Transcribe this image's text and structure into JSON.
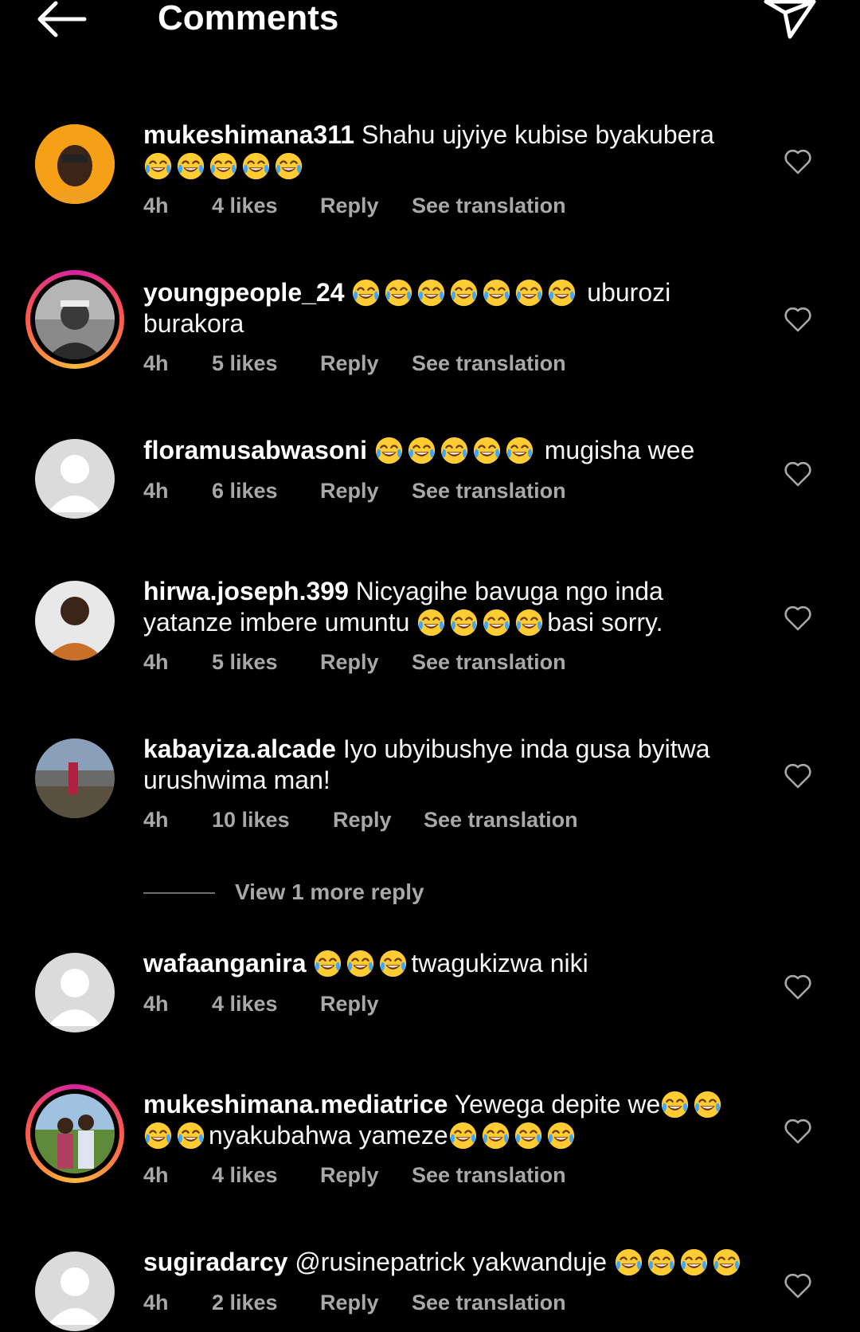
{
  "header": {
    "title": "Comments",
    "back_icon": "arrow-left-icon",
    "share_icon": "send-icon"
  },
  "colors": {
    "background": "#000000",
    "text": "#f5f5f5",
    "meta": "#a8a8a8",
    "story_ring": "#d6249f"
  },
  "comments": [
    {
      "username": "mukeshimana311",
      "text_before": " Shahu ujyiye kubise byakubera",
      "emojis_after_count": 5,
      "time": "4h",
      "likes": "4 likes",
      "reply": "Reply",
      "translation": "See translation",
      "avatar": "avatar-photo",
      "story_ring": false
    },
    {
      "username": "youngpeople_24",
      "emojis_inline_count": 7,
      "text_after": " uburozi burakora",
      "time": "4h",
      "likes": "5 likes",
      "reply": "Reply",
      "translation": "See translation",
      "avatar": "avatar-photo",
      "story_ring": true
    },
    {
      "username": "floramusabwasoni",
      "emojis_inline_count": 5,
      "text_after": " mugisha wee",
      "time": "4h",
      "likes": "6 likes",
      "reply": "Reply",
      "translation": "See translation",
      "avatar": "default-avatar",
      "story_ring": false
    },
    {
      "username": "hirwa.joseph.399",
      "text_before": " Nicyagihe bavuga ngo inda yatanze imbere umuntu ",
      "emojis_inline_count": 4,
      "text_after": "basi sorry.",
      "time": "4h",
      "likes": "5 likes",
      "reply": "Reply",
      "translation": "See translation",
      "avatar": "avatar-photo",
      "story_ring": false
    },
    {
      "username": "kabayiza.alcade",
      "text_before": " Iyo ubyibushye inda gusa byitwa urushwima man!",
      "time": "4h",
      "likes": "10 likes",
      "reply": "Reply",
      "translation": "See translation",
      "avatar": "avatar-photo",
      "story_ring": false
    },
    {
      "username": "wafaanganira",
      "emojis_inline_count": 3,
      "text_after": "twagukizwa niki",
      "time": "4h",
      "likes": "4 likes",
      "reply": "Reply",
      "avatar": "default-avatar",
      "story_ring": false
    },
    {
      "username": "mukeshimana.mediatrice",
      "text_before": " Yewega depite we",
      "emojis_inline_count": 4,
      "text_after": "nyakubahwa yameze",
      "emojis_after_count": 4,
      "time": "4h",
      "likes": "4 likes",
      "reply": "Reply",
      "translation": "See translation",
      "avatar": "avatar-photo",
      "story_ring": true
    },
    {
      "username": "sugiradarcy",
      "text_before": " @rusinepatrick  yakwanduje ",
      "emojis_after_count": 4,
      "time": "4h",
      "likes": "2 likes",
      "reply": "Reply",
      "translation": "See translation",
      "avatar": "default-avatar",
      "story_ring": false
    }
  ],
  "view_more_replies": "View 1 more reply"
}
